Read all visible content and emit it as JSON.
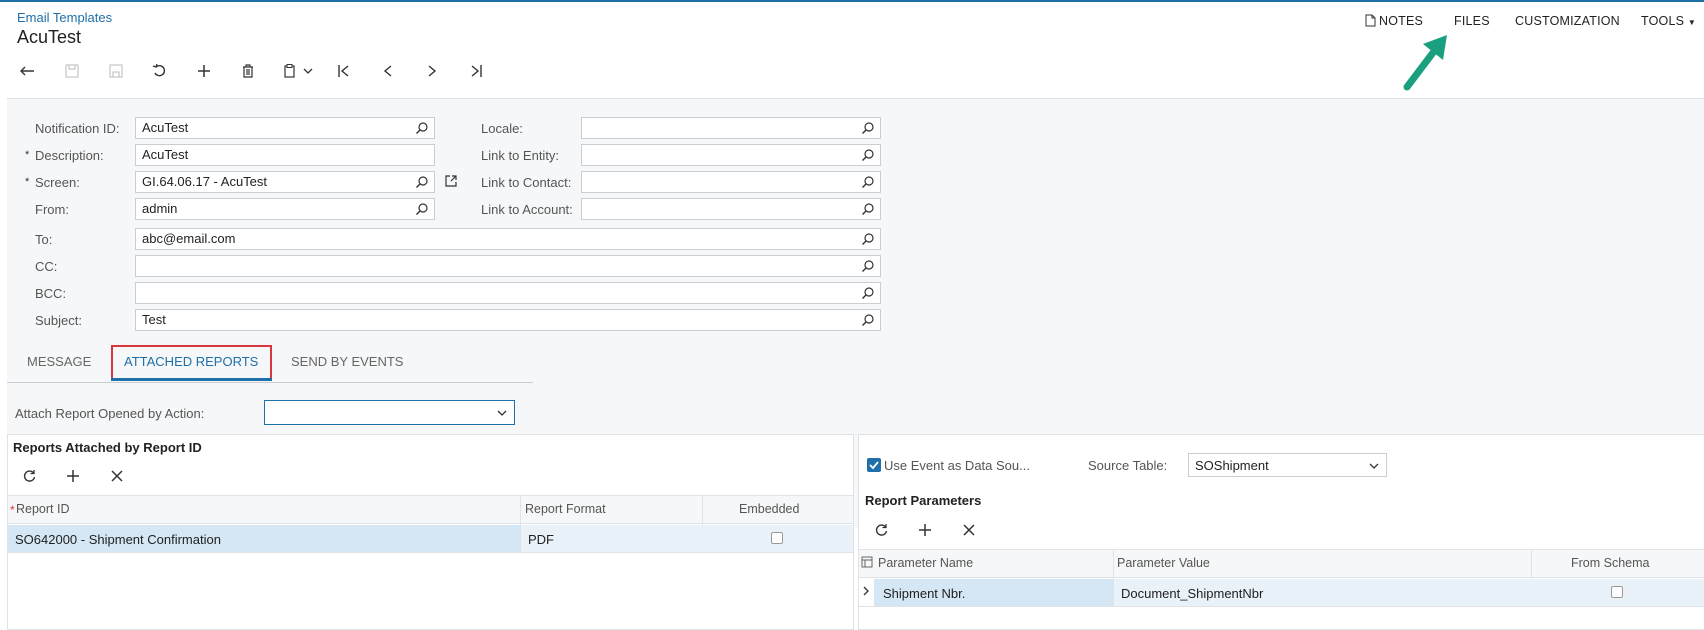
{
  "header": {
    "breadcrumb": "Email Templates",
    "title": "AcuTest",
    "nav": {
      "notes": "NOTES",
      "files": "FILES",
      "customization": "CUSTOMIZATION",
      "tools": "TOOLS"
    }
  },
  "toolbar": {
    "icons": [
      "back-icon",
      "save-close-icon",
      "save-icon",
      "cancel-icon",
      "add-icon",
      "delete-icon",
      "copy-paste-icon",
      "first-icon",
      "previous-icon",
      "next-icon",
      "last-icon"
    ]
  },
  "form": {
    "notification_id": {
      "label": "Notification ID:",
      "value": "AcuTest"
    },
    "description": {
      "label": "Description:",
      "value": "AcuTest",
      "required_mark": "*"
    },
    "screen": {
      "label": "Screen:",
      "value": "GI.64.06.17 - AcuTest",
      "required_mark": "*"
    },
    "from": {
      "label": "From:",
      "value": "admin"
    },
    "to": {
      "label": "To:",
      "value": "abc@email.com"
    },
    "cc": {
      "label": "CC:",
      "value": ""
    },
    "bcc": {
      "label": "BCC:",
      "value": ""
    },
    "subject": {
      "label": "Subject:",
      "value": "Test"
    },
    "locale": {
      "label": "Locale:",
      "value": ""
    },
    "link_entity": {
      "label": "Link to Entity:",
      "value": ""
    },
    "link_contact": {
      "label": "Link to Contact:",
      "value": ""
    },
    "link_account": {
      "label": "Link to Account:",
      "value": ""
    }
  },
  "tabs": {
    "message": "MESSAGE",
    "attached_reports": "ATTACHED REPORTS",
    "send_by_events": "SEND BY EVENTS"
  },
  "attached": {
    "action_label": "Attach Report Opened by Action:",
    "action_value": "",
    "reports_title": "Reports Attached by Report ID",
    "columns": {
      "report_id": "Report ID",
      "report_format": "Report Format",
      "embedded": "Embedded"
    },
    "required_mark": "*",
    "rows": [
      {
        "report_id": "SO642000 - Shipment Confirmation",
        "report_format": "PDF",
        "embedded": false
      }
    ]
  },
  "right": {
    "use_event_label": "Use Event as Data Sou...",
    "use_event_checked": true,
    "source_table_label": "Source Table:",
    "source_table_value": "SOShipment",
    "params_title": "Report Parameters",
    "columns": {
      "name": "Parameter Name",
      "value": "Parameter Value",
      "from_schema": "From Schema"
    },
    "rows": [
      {
        "name": "Shipment Nbr.",
        "value": "Document_ShipmentNbr",
        "from_schema": false
      }
    ]
  },
  "colors": {
    "accent": "#1f6fa8",
    "arrow": "#1a9f7f",
    "highlight_border": "#d9363e",
    "selected_row": "#d5e6f4"
  }
}
